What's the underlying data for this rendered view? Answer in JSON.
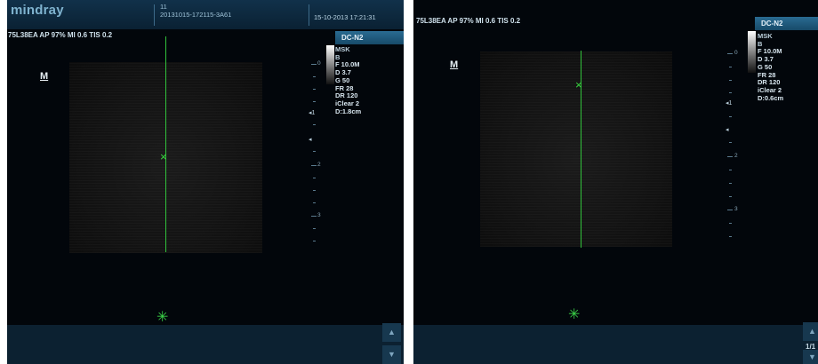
{
  "left": {
    "logo": "mindray",
    "header_line1": "11",
    "exam_id": "20131015-172115-3A61",
    "datetime": "15-10-2013 17:21:31",
    "status": "75L38EA  AP 97%  MI 0.6  TIS 0.2",
    "preset": "DC-N2",
    "mode_badge": "M",
    "params": [
      "MSK",
      "B",
      "F 10.0M",
      "D 3.7",
      "G 50",
      "FR 28",
      "DR 120",
      "iClear 2",
      "D:1.8cm"
    ],
    "depth_labels": [
      "0",
      "1",
      "2",
      "3"
    ],
    "focus_marker": "◂1",
    "focus_marker2": "◂",
    "star_icon": "✳",
    "scroll_up": "▲",
    "scroll_down": "▼"
  },
  "right": {
    "status": "75L38EA  AP 97%  MI 0.6  TIS 0.2",
    "preset": "DC-N2",
    "mode_badge": "M",
    "params": [
      "MSK",
      "B",
      "F 10.0M",
      "D 3.7",
      "G 50",
      "FR 28",
      "DR 120",
      "iClear 2",
      "D:0.6cm"
    ],
    "depth_labels": [
      "0",
      "1",
      "2",
      "3"
    ],
    "focus_marker": "◂1",
    "focus_marker2": "◂",
    "star_icon": "✳",
    "scroll_up": "▲",
    "page_indicator": "1/1",
    "scroll_down": "▼"
  },
  "colors": {
    "accent": "#1e5a80",
    "scan_line": "#31c23b",
    "background": "#02060b"
  }
}
